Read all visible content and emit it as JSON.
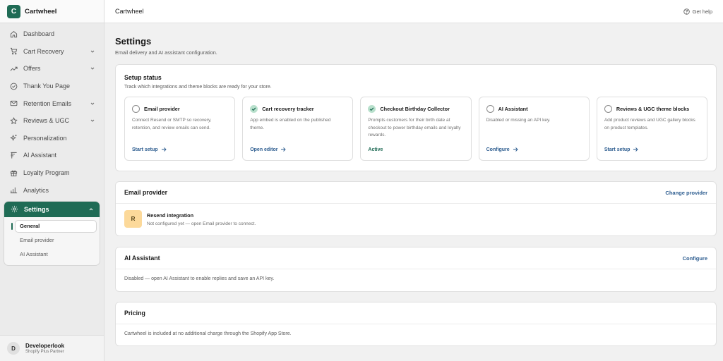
{
  "brand": {
    "logo_letter": "C",
    "name": "Cartwheel"
  },
  "nav": [
    {
      "label": "Dashboard",
      "icon": "home-icon",
      "chevron": false
    },
    {
      "label": "Cart Recovery",
      "icon": "cart-icon",
      "chevron": true
    },
    {
      "label": "Offers",
      "icon": "trend-icon",
      "chevron": true
    },
    {
      "label": "Thank You Page",
      "icon": "check-circle-icon",
      "chevron": false
    },
    {
      "label": "Retention Emails",
      "icon": "mail-icon",
      "chevron": true
    },
    {
      "label": "Reviews & UGC",
      "icon": "star-icon",
      "chevron": true
    },
    {
      "label": "Personalization",
      "icon": "sparkle-icon",
      "chevron": false
    },
    {
      "label": "AI Assistant",
      "icon": "ai-icon",
      "chevron": false
    },
    {
      "label": "Loyalty Program",
      "icon": "gift-icon",
      "chevron": false
    },
    {
      "label": "Analytics",
      "icon": "bar-chart-icon",
      "chevron": false
    }
  ],
  "settings": {
    "label": "Settings",
    "items": [
      "General",
      "Email provider",
      "AI Assistant"
    ],
    "active_index": 0
  },
  "user": {
    "initial": "D",
    "name": "Developerlook",
    "role": "Shopify Plus Partner"
  },
  "topbar": {
    "title": "Cartwheel",
    "help": "Get help"
  },
  "page": {
    "title": "Settings",
    "subtitle": "Email delivery and AI assistant configuration."
  },
  "setup": {
    "title": "Setup status",
    "subtitle": "Track which integrations and theme blocks are ready for your store.",
    "tiles": [
      {
        "title": "Email provider",
        "done": false,
        "desc": "Connect Resend or SMTP so recovery, retention, and review emails can send.",
        "link": "Start setup",
        "status": ""
      },
      {
        "title": "Cart recovery tracker",
        "done": true,
        "desc": "App embed is enabled on the published theme.",
        "link": "Open editor",
        "status": ""
      },
      {
        "title": "Checkout Birthday Collector",
        "done": true,
        "desc": "Prompts customers for their birth date at checkout to power birthday emails and loyalty rewards.",
        "link": "",
        "status": "Active"
      },
      {
        "title": "AI Assistant",
        "done": false,
        "desc": "Disabled or missing an API key.",
        "link": "Configure",
        "status": ""
      },
      {
        "title": "Reviews & UGC theme blocks",
        "done": false,
        "desc": "Add product reviews and UGC gallery blocks on product templates.",
        "link": "Start setup",
        "status": ""
      }
    ]
  },
  "email_provider": {
    "title": "Email provider",
    "action": "Change provider",
    "badge": "R",
    "integration_title": "Resend integration",
    "integration_sub": "Not configured yet — open Email provider to connect."
  },
  "ai_assistant": {
    "title": "AI Assistant",
    "action": "Configure",
    "text": "Disabled — open AI Assistant to enable replies and save an API key."
  },
  "pricing": {
    "title": "Pricing",
    "text": "Cartwheel is included at no additional charge through the Shopify App Store."
  },
  "colors": {
    "accent": "#1f6b55",
    "link": "#2c5c8f",
    "badge": "#fcd99a",
    "check_bg": "#b8e0cc"
  }
}
